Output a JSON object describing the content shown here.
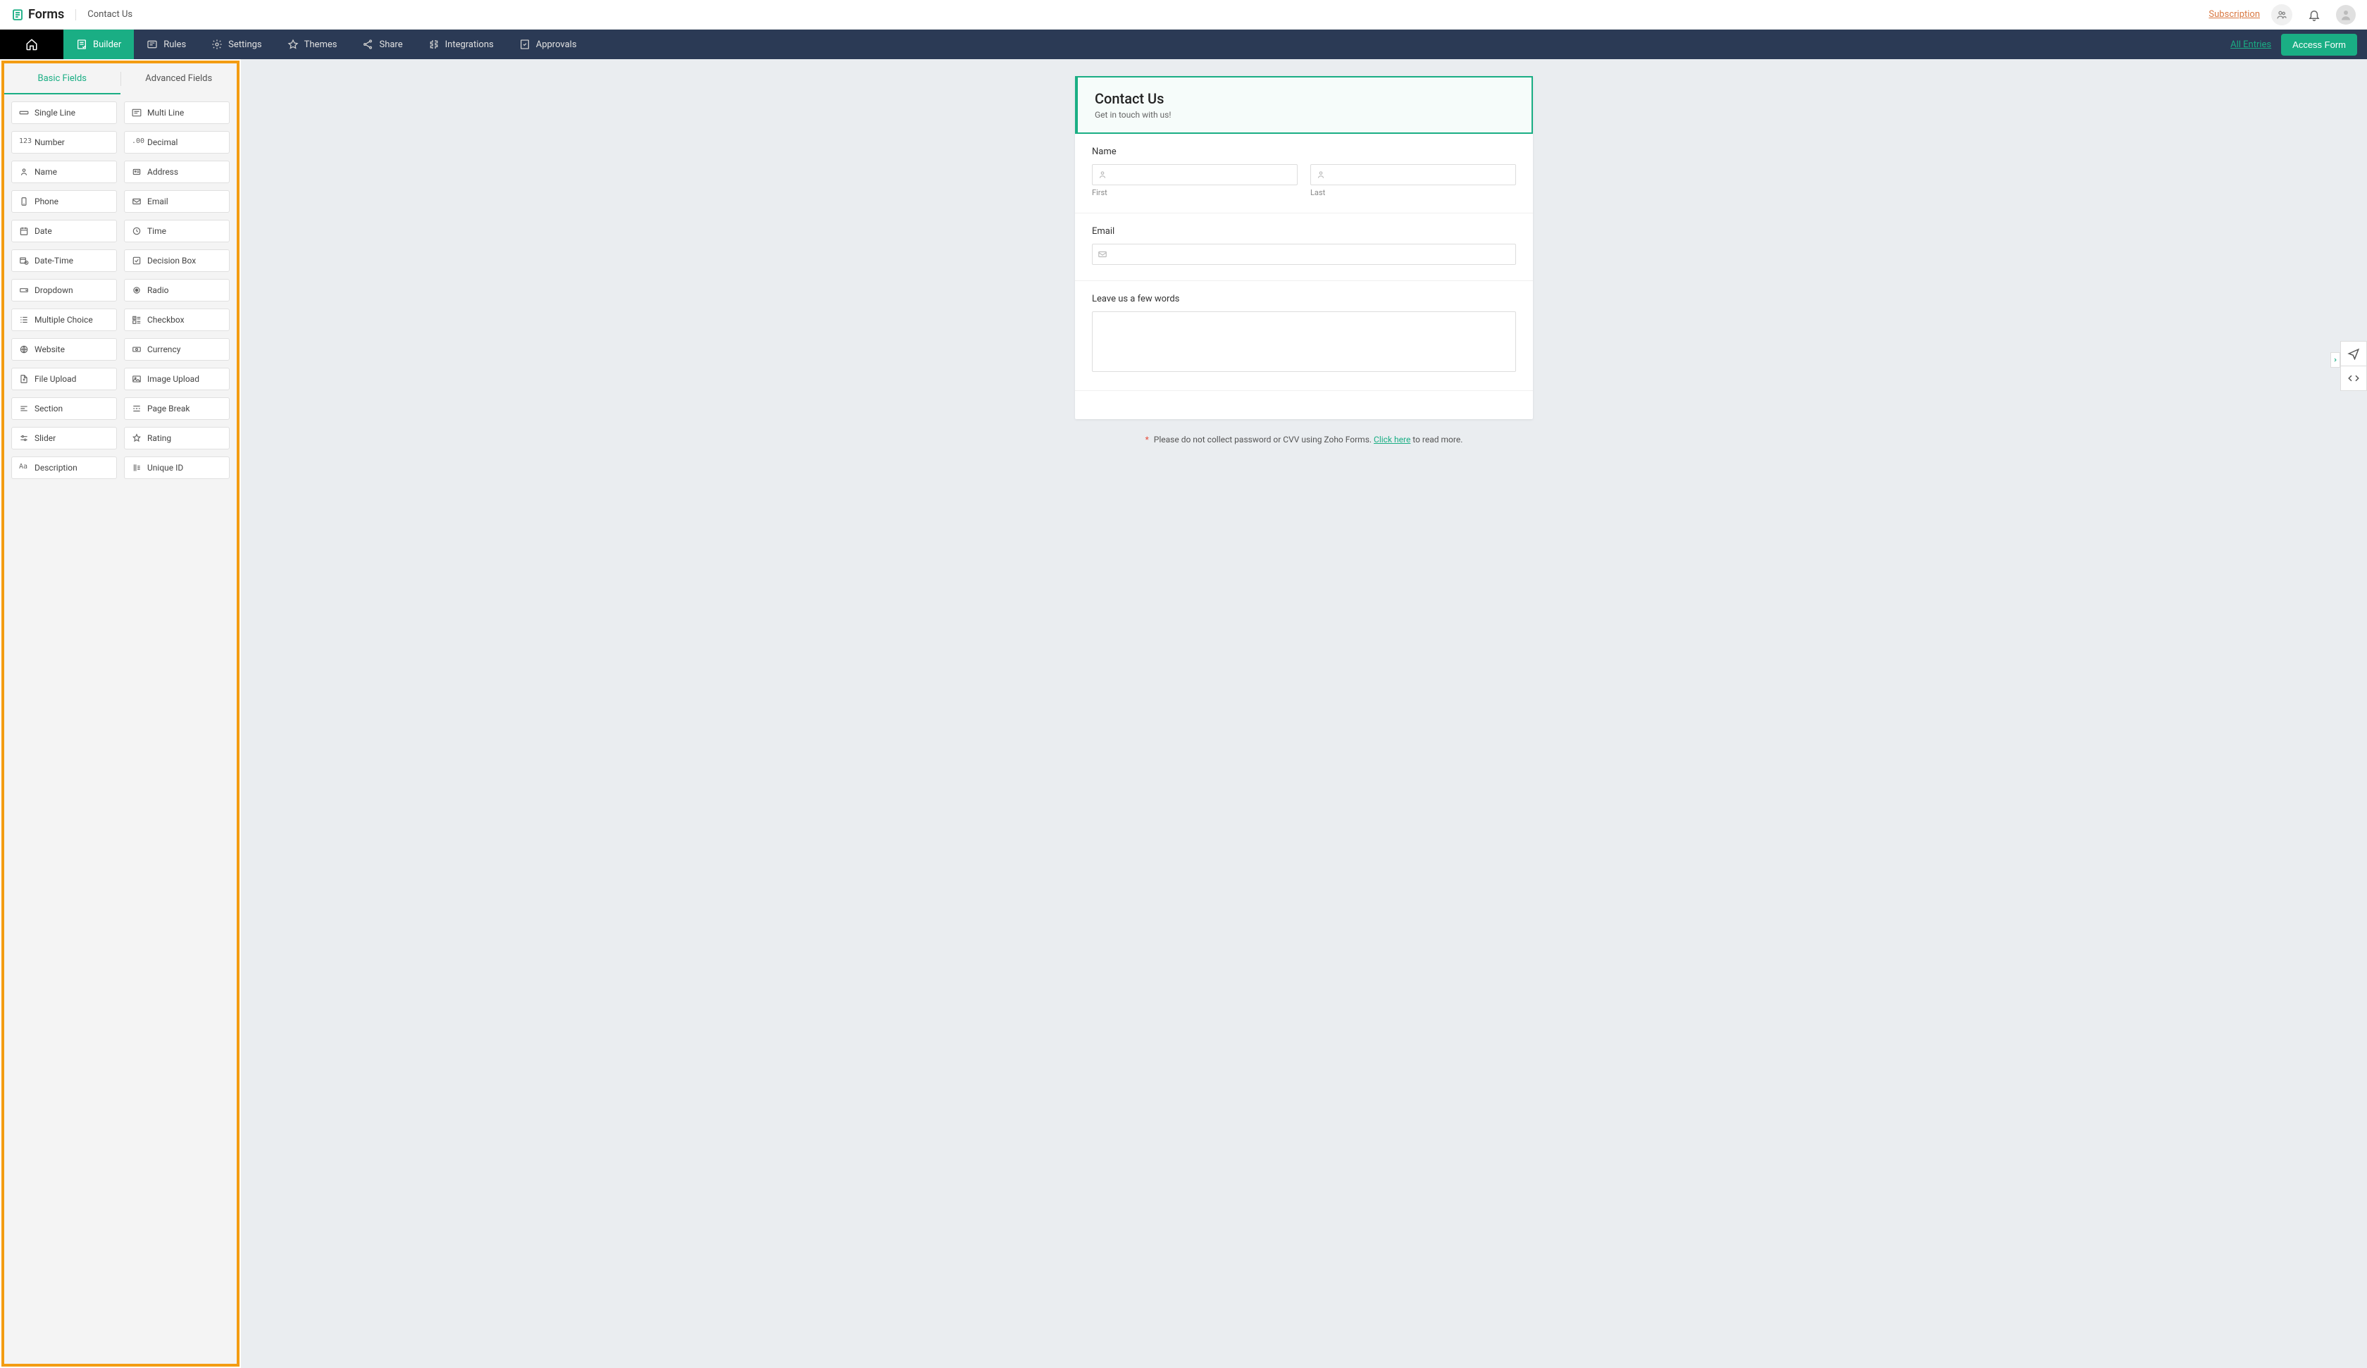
{
  "header": {
    "logo_text": "Forms",
    "breadcrumb": "Contact Us",
    "subscription": "Subscription"
  },
  "nav": {
    "items": [
      {
        "label": "Builder"
      },
      {
        "label": "Rules"
      },
      {
        "label": "Settings"
      },
      {
        "label": "Themes"
      },
      {
        "label": "Share"
      },
      {
        "label": "Integrations"
      },
      {
        "label": "Approvals"
      }
    ],
    "all_entries": "All Entries",
    "access_form": "Access Form"
  },
  "fieldtabs": {
    "basic": "Basic Fields",
    "advanced": "Advanced Fields"
  },
  "fields": [
    {
      "label": "Single Line"
    },
    {
      "label": "Multi Line"
    },
    {
      "label": "Number"
    },
    {
      "label": "Decimal"
    },
    {
      "label": "Name"
    },
    {
      "label": "Address"
    },
    {
      "label": "Phone"
    },
    {
      "label": "Email"
    },
    {
      "label": "Date"
    },
    {
      "label": "Time"
    },
    {
      "label": "Date-Time"
    },
    {
      "label": "Decision Box"
    },
    {
      "label": "Dropdown"
    },
    {
      "label": "Radio"
    },
    {
      "label": "Multiple Choice"
    },
    {
      "label": "Checkbox"
    },
    {
      "label": "Website"
    },
    {
      "label": "Currency"
    },
    {
      "label": "File Upload"
    },
    {
      "label": "Image Upload"
    },
    {
      "label": "Section"
    },
    {
      "label": "Page Break"
    },
    {
      "label": "Slider"
    },
    {
      "label": "Rating"
    },
    {
      "label": "Description"
    },
    {
      "label": "Unique ID"
    }
  ],
  "form": {
    "title": "Contact Us",
    "subtitle": "Get in touch with us!",
    "name_label": "Name",
    "first_label": "First",
    "last_label": "Last",
    "email_label": "Email",
    "message_label": "Leave us a few words"
  },
  "footer": {
    "asterisk": "*",
    "text_pre": "Please do not collect password or CVV using Zoho Forms. ",
    "link": "Click here",
    "text_post": " to read more."
  }
}
